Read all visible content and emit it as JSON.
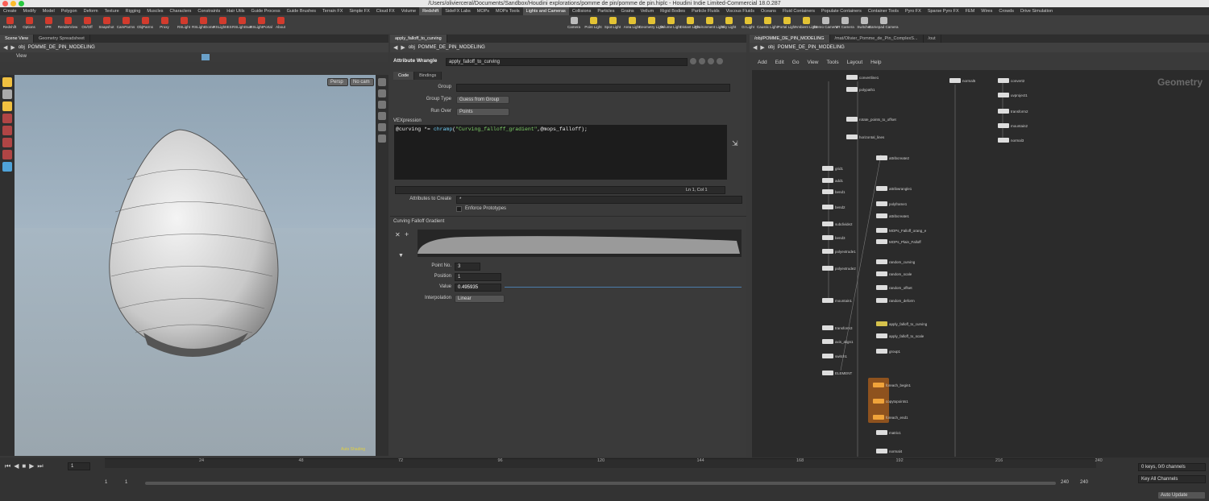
{
  "window": {
    "title": "/Users/olivierceral/Documents/Sandbox/Houdini explorations/pomme de pin/pomme de pin.hiplc - Houdini Indie Limited-Commercial 18.0.287"
  },
  "shelf_tabs": [
    "Create",
    "Modify",
    "Model",
    "Polygon",
    "Deform",
    "Texture",
    "Rigging",
    "Muscles",
    "Characters",
    "Constraints",
    "Hair Utils",
    "Guide Process",
    "Guide Brushes",
    "Terrain FX",
    "Simple FX",
    "Cloud FX",
    "Volume",
    "Redshift",
    "SideFX Labs",
    "MOPs",
    "MOPs Tools"
  ],
  "shelf_tabs_right": [
    "Lights and Cameras",
    "Collisions",
    "Particles",
    "Grains",
    "Vellum",
    "Rigid Bodies",
    "Particle Fluids",
    "Viscous Fluids",
    "Oceans",
    "Fluid Containers",
    "Populate Containers",
    "Container Tools",
    "Pyro FX",
    "Sparse Pyro FX",
    "FEM",
    "Wires",
    "Crowds",
    "Drive Simulation"
  ],
  "shelf_tools": [
    {
      "label": "Redshift",
      "color": "#d23b2d"
    },
    {
      "label": "Options",
      "color": "#d23b2d"
    },
    {
      "label": "IPR",
      "color": "#d23b2d"
    },
    {
      "label": "RenderView",
      "color": "#d23b2d"
    },
    {
      "label": "On/Off",
      "color": "#d23b2d"
    },
    {
      "label": "Snapshot",
      "color": "#d23b2d"
    },
    {
      "label": "CamParms",
      "color": "#d23b2d"
    },
    {
      "label": "ObjParms",
      "color": "#d23b2d"
    },
    {
      "label": "Proxy",
      "color": "#d23b2d"
    },
    {
      "label": "RSLight",
      "color": "#d23b2d"
    },
    {
      "label": "RSLightDome",
      "color": "#d23b2d"
    },
    {
      "label": "RSLightIES",
      "color": "#d23b2d"
    },
    {
      "label": "RSLightSun",
      "color": "#d23b2d"
    },
    {
      "label": "RSLightPortal",
      "color": "#d23b2d"
    },
    {
      "label": "About",
      "color": "#d23b2d"
    }
  ],
  "shelf_tools_right": [
    {
      "label": "Camera",
      "color": "#bbbbbb"
    },
    {
      "label": "Point Light",
      "color": "#e3c334"
    },
    {
      "label": "Spot Light",
      "color": "#e3c334"
    },
    {
      "label": "Area Light",
      "color": "#e3c334"
    },
    {
      "label": "Geometry Light",
      "color": "#e3c334"
    },
    {
      "label": "Volume Light",
      "color": "#e3c334"
    },
    {
      "label": "Distant Light",
      "color": "#e3c334"
    },
    {
      "label": "Environment Light",
      "color": "#e3c334"
    },
    {
      "label": "Sky Light",
      "color": "#e3c334"
    },
    {
      "label": "GI Light",
      "color": "#e3c334"
    },
    {
      "label": "Caustic Light",
      "color": "#e3c334"
    },
    {
      "label": "Portal Light",
      "color": "#e3c334"
    },
    {
      "label": "Ambient Light",
      "color": "#e3c334"
    },
    {
      "label": "Stereo Camera",
      "color": "#bbbbbb"
    },
    {
      "label": "VR Camera",
      "color": "#bbbbbb"
    },
    {
      "label": "Switcher",
      "color": "#bbbbbb"
    },
    {
      "label": "Gamepad Camera",
      "color": "#bbbbbb"
    }
  ],
  "scene": {
    "tabs": [
      "Scene View",
      "Geometry Spreadsheet"
    ],
    "path_root": "obj",
    "path_node": "POMME_DE_PIN_MODELING",
    "view_label": "View",
    "persp": "Persp",
    "cam": "No cam",
    "status": "Auto Shading"
  },
  "params": {
    "tab": "apply_falloff_to_curving",
    "path_root": "obj",
    "path_node": "POMME_DE_PIN_MODELING",
    "node_type": "Attribute Wrangle",
    "node_name": "apply_falloff_to_curving",
    "subtabs": [
      "Code",
      "Bindings"
    ],
    "group_label": "Group",
    "group_value": "",
    "group_type_label": "Group Type",
    "group_type_value": "Guess from Group",
    "run_over_label": "Run Over",
    "run_over_value": "Points",
    "vex_label": "VEXpression",
    "code_prefix": "@curving *= ",
    "code_fn": "chramp",
    "code_open": "(",
    "code_str": "\"Curving_falloff_gradient\"",
    "code_rest": ",@mops_falloff);",
    "cursor": "Ln 1, Col 1",
    "attrs_label": "Attributes to Create",
    "attrs_value": "*",
    "enforce_label": "Enforce Prototypes",
    "ramp_label": "Curving Falloff Gradient",
    "point_no_label": "Point No.",
    "point_no": "3",
    "position_label": "Position",
    "position": "1",
    "value_label": "Value",
    "value": "0.495935",
    "interp_label": "Interpolation",
    "interp": "Linear"
  },
  "network": {
    "tabs": [
      "/obj/POMME_DE_PIN_MODELING",
      "/mat/Olivier_Pomme_de_Pin_ComplexS...",
      "/out"
    ],
    "path_root": "obj",
    "path_node": "POMME_DE_PIN_MODELING",
    "menu": [
      "Add",
      "Edit",
      "Go",
      "View",
      "Tools",
      "Layout",
      "Help"
    ],
    "context": "Geometry",
    "nodes": [
      {
        "n": "convertline1",
        "c": "w"
      },
      {
        "n": "polypath1",
        "c": "w"
      },
      {
        "n": "rotate_points_to_offset",
        "c": "w"
      },
      {
        "n": "horizontal_lines",
        "c": "w"
      },
      {
        "n": "attribcreate2",
        "c": "w"
      },
      {
        "n": "grid1",
        "c": "w"
      },
      {
        "n": "add1",
        "c": "w"
      },
      {
        "n": "bend1",
        "c": "w"
      },
      {
        "n": "bend2",
        "c": "w"
      },
      {
        "n": "subdivide2",
        "c": "w"
      },
      {
        "n": "bend3",
        "c": "w"
      },
      {
        "n": "polyextrude1",
        "c": "w"
      },
      {
        "n": "polyextrude2",
        "c": "w"
      },
      {
        "n": "mountain1",
        "c": "w"
      },
      {
        "n": "transform3",
        "c": "w"
      },
      {
        "n": "axis_align1",
        "c": "w"
      },
      {
        "n": "switch1",
        "c": "w"
      },
      {
        "n": "ELEMENT",
        "c": "w"
      },
      {
        "n": "attribwrangle1",
        "c": "w"
      },
      {
        "n": "polyframe1",
        "c": "w"
      },
      {
        "n": "attribcreate1",
        "c": "w"
      },
      {
        "n": "MOPs_Falloff_orang_e",
        "c": "w"
      },
      {
        "n": "MOPs_Plain_Falloff",
        "c": "w"
      },
      {
        "n": "random_curving",
        "c": "w"
      },
      {
        "n": "random_scale",
        "c": "w"
      },
      {
        "n": "random_offset",
        "c": "w"
      },
      {
        "n": "random_deform",
        "c": "w"
      },
      {
        "n": "apply_falloff_to_curving",
        "c": "y"
      },
      {
        "n": "apply_falloff_to_scale",
        "c": "w"
      },
      {
        "n": "group1",
        "c": "w"
      },
      {
        "n": "foreach_begin1",
        "c": "o"
      },
      {
        "n": "copytopoints1",
        "c": "o"
      },
      {
        "n": "foreach_end1",
        "c": "o"
      },
      {
        "n": "matrix1",
        "c": "w"
      },
      {
        "n": "normal4",
        "c": "w"
      },
      {
        "n": "normal5",
        "c": "w"
      },
      {
        "n": "convert2",
        "c": "w"
      },
      {
        "n": "uvproject1",
        "c": "w"
      },
      {
        "n": "transform2",
        "c": "w"
      },
      {
        "n": "mountain2",
        "c": "w"
      },
      {
        "n": "normal3",
        "c": "w"
      }
    ]
  },
  "timeline": {
    "start": "1",
    "frame": "1",
    "ticks": [
      "24",
      "48",
      "72",
      "96",
      "120",
      "144",
      "168",
      "192",
      "216",
      "240"
    ],
    "end_a": "240",
    "end_b": "240",
    "keys": "0 keys, 0/0 channels",
    "key_all": "Key All Channels",
    "auto_update": "Auto Update"
  }
}
